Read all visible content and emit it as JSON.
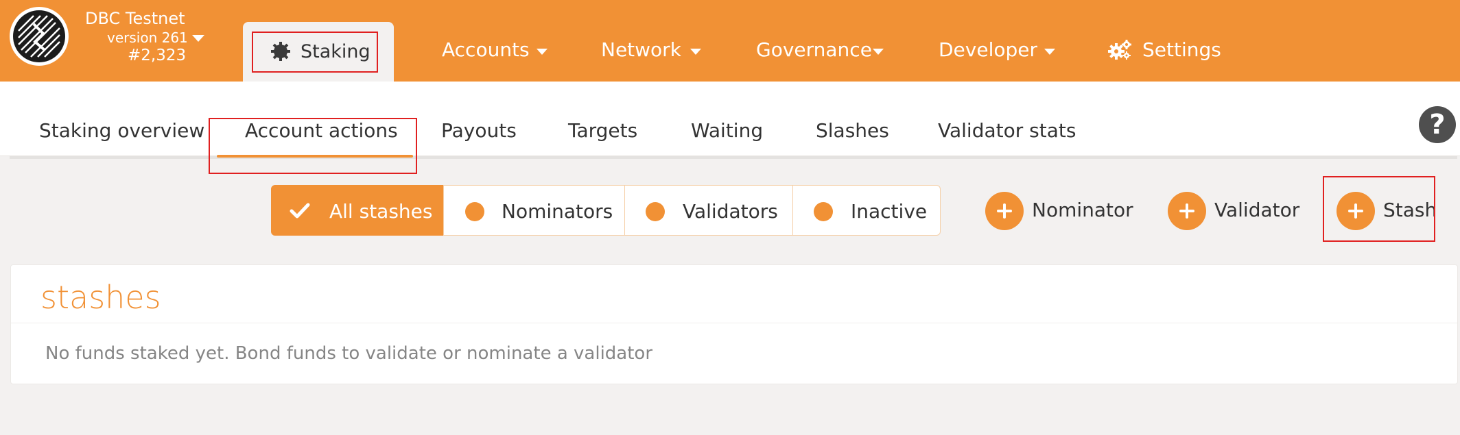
{
  "colors": {
    "accent": "#f19135",
    "highlight": "#e02020",
    "background": "#f3f1f0"
  },
  "header": {
    "chain_name": "DBC Testnet",
    "version": "version 261",
    "block": "#2,323",
    "logo_icon": "dbc-logo-icon"
  },
  "topnav": {
    "staking": {
      "label": "Staking",
      "icon": "staking-gear-icon"
    },
    "items": [
      {
        "label": "Accounts"
      },
      {
        "label": "Network"
      },
      {
        "label": "Governance"
      },
      {
        "label": "Developer"
      }
    ],
    "settings": {
      "label": "Settings",
      "icon": "gears-icon"
    }
  },
  "subnav": {
    "tabs": [
      {
        "label": "Staking overview"
      },
      {
        "label": "Account actions"
      },
      {
        "label": "Payouts"
      },
      {
        "label": "Targets"
      },
      {
        "label": "Waiting"
      },
      {
        "label": "Slashes"
      },
      {
        "label": "Validator stats"
      }
    ],
    "active_tab": "Account actions",
    "help_icon": "?"
  },
  "filters": [
    {
      "label": "All stashes",
      "active": true
    },
    {
      "label": "Nominators",
      "active": false
    },
    {
      "label": "Validators",
      "active": false
    },
    {
      "label": "Inactive",
      "active": false
    }
  ],
  "add_buttons": [
    {
      "label": "Nominator"
    },
    {
      "label": "Validator"
    },
    {
      "label": "Stash"
    }
  ],
  "panel": {
    "title": "stashes",
    "empty_message": "No funds staked yet. Bond funds to validate or nominate a validator"
  }
}
